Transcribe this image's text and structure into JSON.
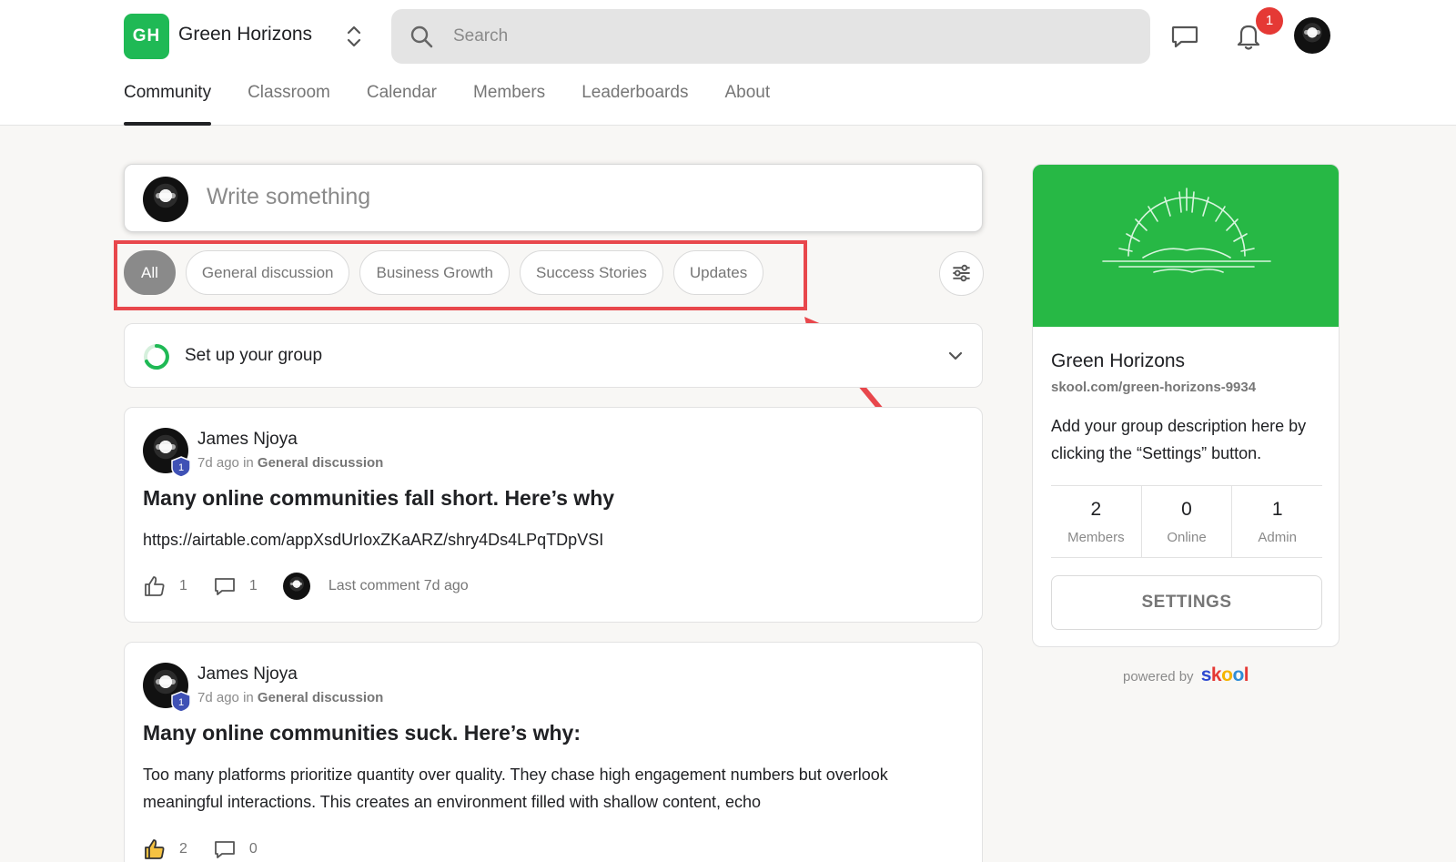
{
  "header": {
    "logo_text": "GH",
    "group_name": "Green Horizons",
    "search_placeholder": "Search",
    "notification_count": "1"
  },
  "nav": {
    "tabs": [
      "Community",
      "Classroom",
      "Calendar",
      "Members",
      "Leaderboards",
      "About"
    ],
    "active": "Community"
  },
  "composer": {
    "placeholder": "Write something"
  },
  "filters": {
    "chips": [
      "All",
      "General discussion",
      "Business Growth",
      "Success Stories",
      "Updates"
    ],
    "active": "All"
  },
  "setup": {
    "title": "Set up your group"
  },
  "posts": [
    {
      "author": "James Njoya",
      "level": "1",
      "time": "7d ago",
      "in_word": "in",
      "category": "General discussion",
      "title": "Many online communities fall short. Here’s why",
      "body": "https://airtable.com/appXsdUrIoxZKaARZ/shry4Ds4LPqTDpVSI",
      "likes": "1",
      "comments": "1",
      "last_comment": "Last comment 7d ago"
    },
    {
      "author": "James Njoya",
      "level": "1",
      "time": "7d ago",
      "in_word": "in",
      "category": "General discussion",
      "title": "Many online communities suck. Here’s why:",
      "body": "Too many platforms prioritize quantity over quality. They chase high engagement numbers but overlook meaningful interactions. This creates an environment filled with shallow content, echo",
      "likes": "2",
      "comments": "0"
    }
  ],
  "sidebar": {
    "group_name": "Green Horizons",
    "url": "skool.com/green-horizons-9934",
    "description": "Add your group description here by clicking the “Settings” button.",
    "stats": [
      {
        "value": "2",
        "label": "Members"
      },
      {
        "value": "0",
        "label": "Online"
      },
      {
        "value": "1",
        "label": "Admin"
      }
    ],
    "settings_label": "SETTINGS",
    "powered_by": "powered by",
    "brand": "skool"
  },
  "colors": {
    "brand_green": "#27b845",
    "highlight_red": "#e8474c",
    "badge_red": "#e53935",
    "level_blue": "#3f51b5"
  }
}
